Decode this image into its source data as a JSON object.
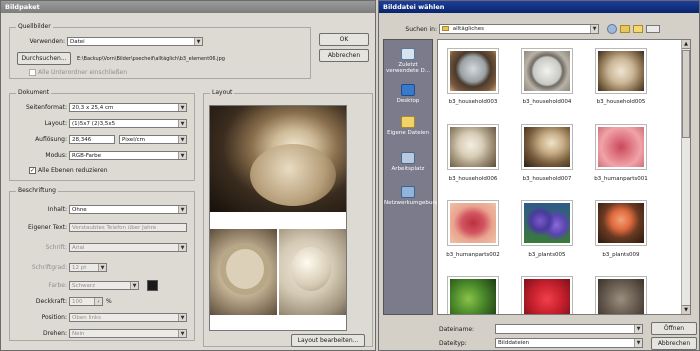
{
  "left_window": {
    "title": "Bildpaket",
    "source": {
      "legend": "Quellbilder",
      "use_label": "Verwenden:",
      "use_value": "Datei",
      "browse_button": "Durchsuchen...",
      "path": "E:\\Backup\\Vorn\\Bilder\\psecheif\\alltäglich\\b3_element06.jpg",
      "subfolder_label": "Alle Unterordner einschließen"
    },
    "ok_button": "OK",
    "cancel_button": "Abbrechen",
    "document": {
      "legend": "Dokument",
      "page_size_label": "Seitenformat:",
      "page_size_value": "20,3 x 25,4 cm",
      "layout_label": "Layout:",
      "layout_value": "(1)5x7 (2)3,5x5",
      "resolution_label": "Auflösung:",
      "resolution_value": "28,346",
      "resolution_unit": "Pixel/cm",
      "mode_label": "Modus:",
      "mode_value": "RGB-Farbe",
      "flatten_label": "Alle Ebenen reduzieren"
    },
    "caption": {
      "legend": "Beschriftung",
      "content_label": "Inhalt:",
      "content_value": "Ohne",
      "custom_text_label": "Eigener Text:",
      "custom_text_value": "Verstaubtes Telefon über Jahre",
      "font_label": "Schrift:",
      "font_value": "Arial",
      "font_size_label": "Schriftgrad:",
      "font_size_value": "12 pt",
      "color_label": "Farbe:",
      "color_value": "Schwarz",
      "opacity_label": "Deckkraft:",
      "opacity_value": "100",
      "opacity_unit": "%",
      "position_label": "Position:",
      "position_value": "Oben links",
      "rotate_label": "Drehen:",
      "rotate_value": "Nein"
    },
    "layout_panel": {
      "legend": "Layout",
      "edit_button": "Layout bearbeiten..."
    }
  },
  "right_window": {
    "title": "Bilddatei wählen",
    "look_in_label": "Suchen in:",
    "look_in_value": "alltägliches",
    "places": [
      {
        "label": "Zuletzt verwendete D...",
        "icon": "recent-icon"
      },
      {
        "label": "Desktop",
        "icon": "desktop-icon"
      },
      {
        "label": "Eigene Dateien",
        "icon": "documents-icon"
      },
      {
        "label": "Arbeitsplatz",
        "icon": "computer-icon"
      },
      {
        "label": "Netzwerkumgebung",
        "icon": "network-icon"
      }
    ],
    "files": [
      {
        "name": "b3_household003"
      },
      {
        "name": "b3_household004"
      },
      {
        "name": "b3_household005"
      },
      {
        "name": "b3_household006"
      },
      {
        "name": "b3_household007"
      },
      {
        "name": "b3_humanparts001"
      },
      {
        "name": "b3_humanparts002"
      },
      {
        "name": "b3_plants005"
      },
      {
        "name": "b3_plants009"
      },
      {
        "name": ""
      },
      {
        "name": ""
      },
      {
        "name": ""
      }
    ],
    "filename_label": "Dateiname:",
    "filename_value": "",
    "filetype_label": "Dateityp:",
    "filetype_value": "Bilddateien",
    "open_button": "Öffnen",
    "cancel_button": "Abbrechen",
    "colors": {
      "titlebar": "#0a246a",
      "sidebar": "#7b7b8c"
    }
  }
}
